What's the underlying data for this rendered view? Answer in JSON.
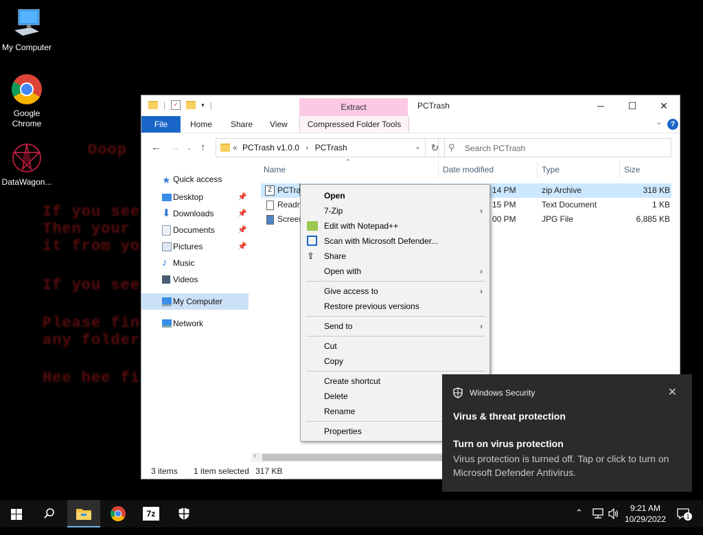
{
  "desktop": {
    "icons": [
      {
        "label": "My Computer"
      },
      {
        "label": "Google Chrome"
      },
      {
        "label": "DataWagon..."
      }
    ]
  },
  "explorer": {
    "title": "PCTrash",
    "ribbon_context_tab": "Extract",
    "tabs": [
      "File",
      "Home",
      "Share",
      "View",
      "Compressed Folder Tools"
    ],
    "address": {
      "prefix": "«",
      "parts": [
        "PCTrash v1.0.0",
        "PCTrash"
      ]
    },
    "search_placeholder": "Search PCTrash",
    "nav": [
      {
        "label": "Quick access",
        "icon": "star-icon"
      },
      {
        "label": "Desktop",
        "icon": "desktop-icon",
        "pinned": true
      },
      {
        "label": "Downloads",
        "icon": "download-icon",
        "pinned": true
      },
      {
        "label": "Documents",
        "icon": "documents-icon",
        "pinned": true
      },
      {
        "label": "Pictures",
        "icon": "pictures-icon",
        "pinned": true
      },
      {
        "label": "Music",
        "icon": "music-icon"
      },
      {
        "label": "Videos",
        "icon": "videos-icon"
      },
      {
        "label": "My Computer",
        "icon": "computer-icon",
        "selected": true
      },
      {
        "label": "Network",
        "icon": "network-icon"
      }
    ],
    "columns": {
      "name": "Name",
      "date": "Date modified",
      "type": "Type",
      "size": "Size"
    },
    "files": [
      {
        "name": "PCTras",
        "date": "14 PM",
        "type": "zip Archive",
        "size": "318 KB",
        "selected": true
      },
      {
        "name": "Readm",
        "date": "15 PM",
        "type": "Text Document",
        "size": "1 KB"
      },
      {
        "name": "Screen",
        "date": "00 PM",
        "type": "JPG File",
        "size": "6,885 KB"
      }
    ],
    "status": {
      "items": "3 items",
      "selected": "1 item selected",
      "size": "317 KB"
    }
  },
  "context_menu": {
    "items": {
      "open": "Open",
      "zip": "7-Zip",
      "notepad": "Edit with Notepad++",
      "defender": "Scan with Microsoft Defender...",
      "share": "Share",
      "open_with": "Open with",
      "give_access": "Give access to",
      "restore": "Restore previous versions",
      "send_to": "Send to",
      "cut": "Cut",
      "copy": "Copy",
      "create_shortcut": "Create shortcut",
      "delete": "Delete",
      "rename": "Rename",
      "properties": "Properties"
    }
  },
  "toast": {
    "app": "Windows Security",
    "heading": "Virus & threat protection",
    "title": "Turn on virus protection",
    "body": "Virus protection is turned off. Tap or click to turn on Microsoft Defender Antivirus."
  },
  "taskbar": {
    "time": "9:21 AM",
    "date": "10/29/2022",
    "notification_count": "1",
    "apps": [
      "start-icon",
      "search-icon",
      "file-explorer-icon",
      "chrome-icon",
      "7zip-icon",
      "windows-security-icon"
    ]
  },
  "colors": {
    "accent": "#1a66c8",
    "selection": "#cce8ff",
    "extract_tab": "#fbc9e4",
    "toast_bg": "#2b2b2b"
  }
}
